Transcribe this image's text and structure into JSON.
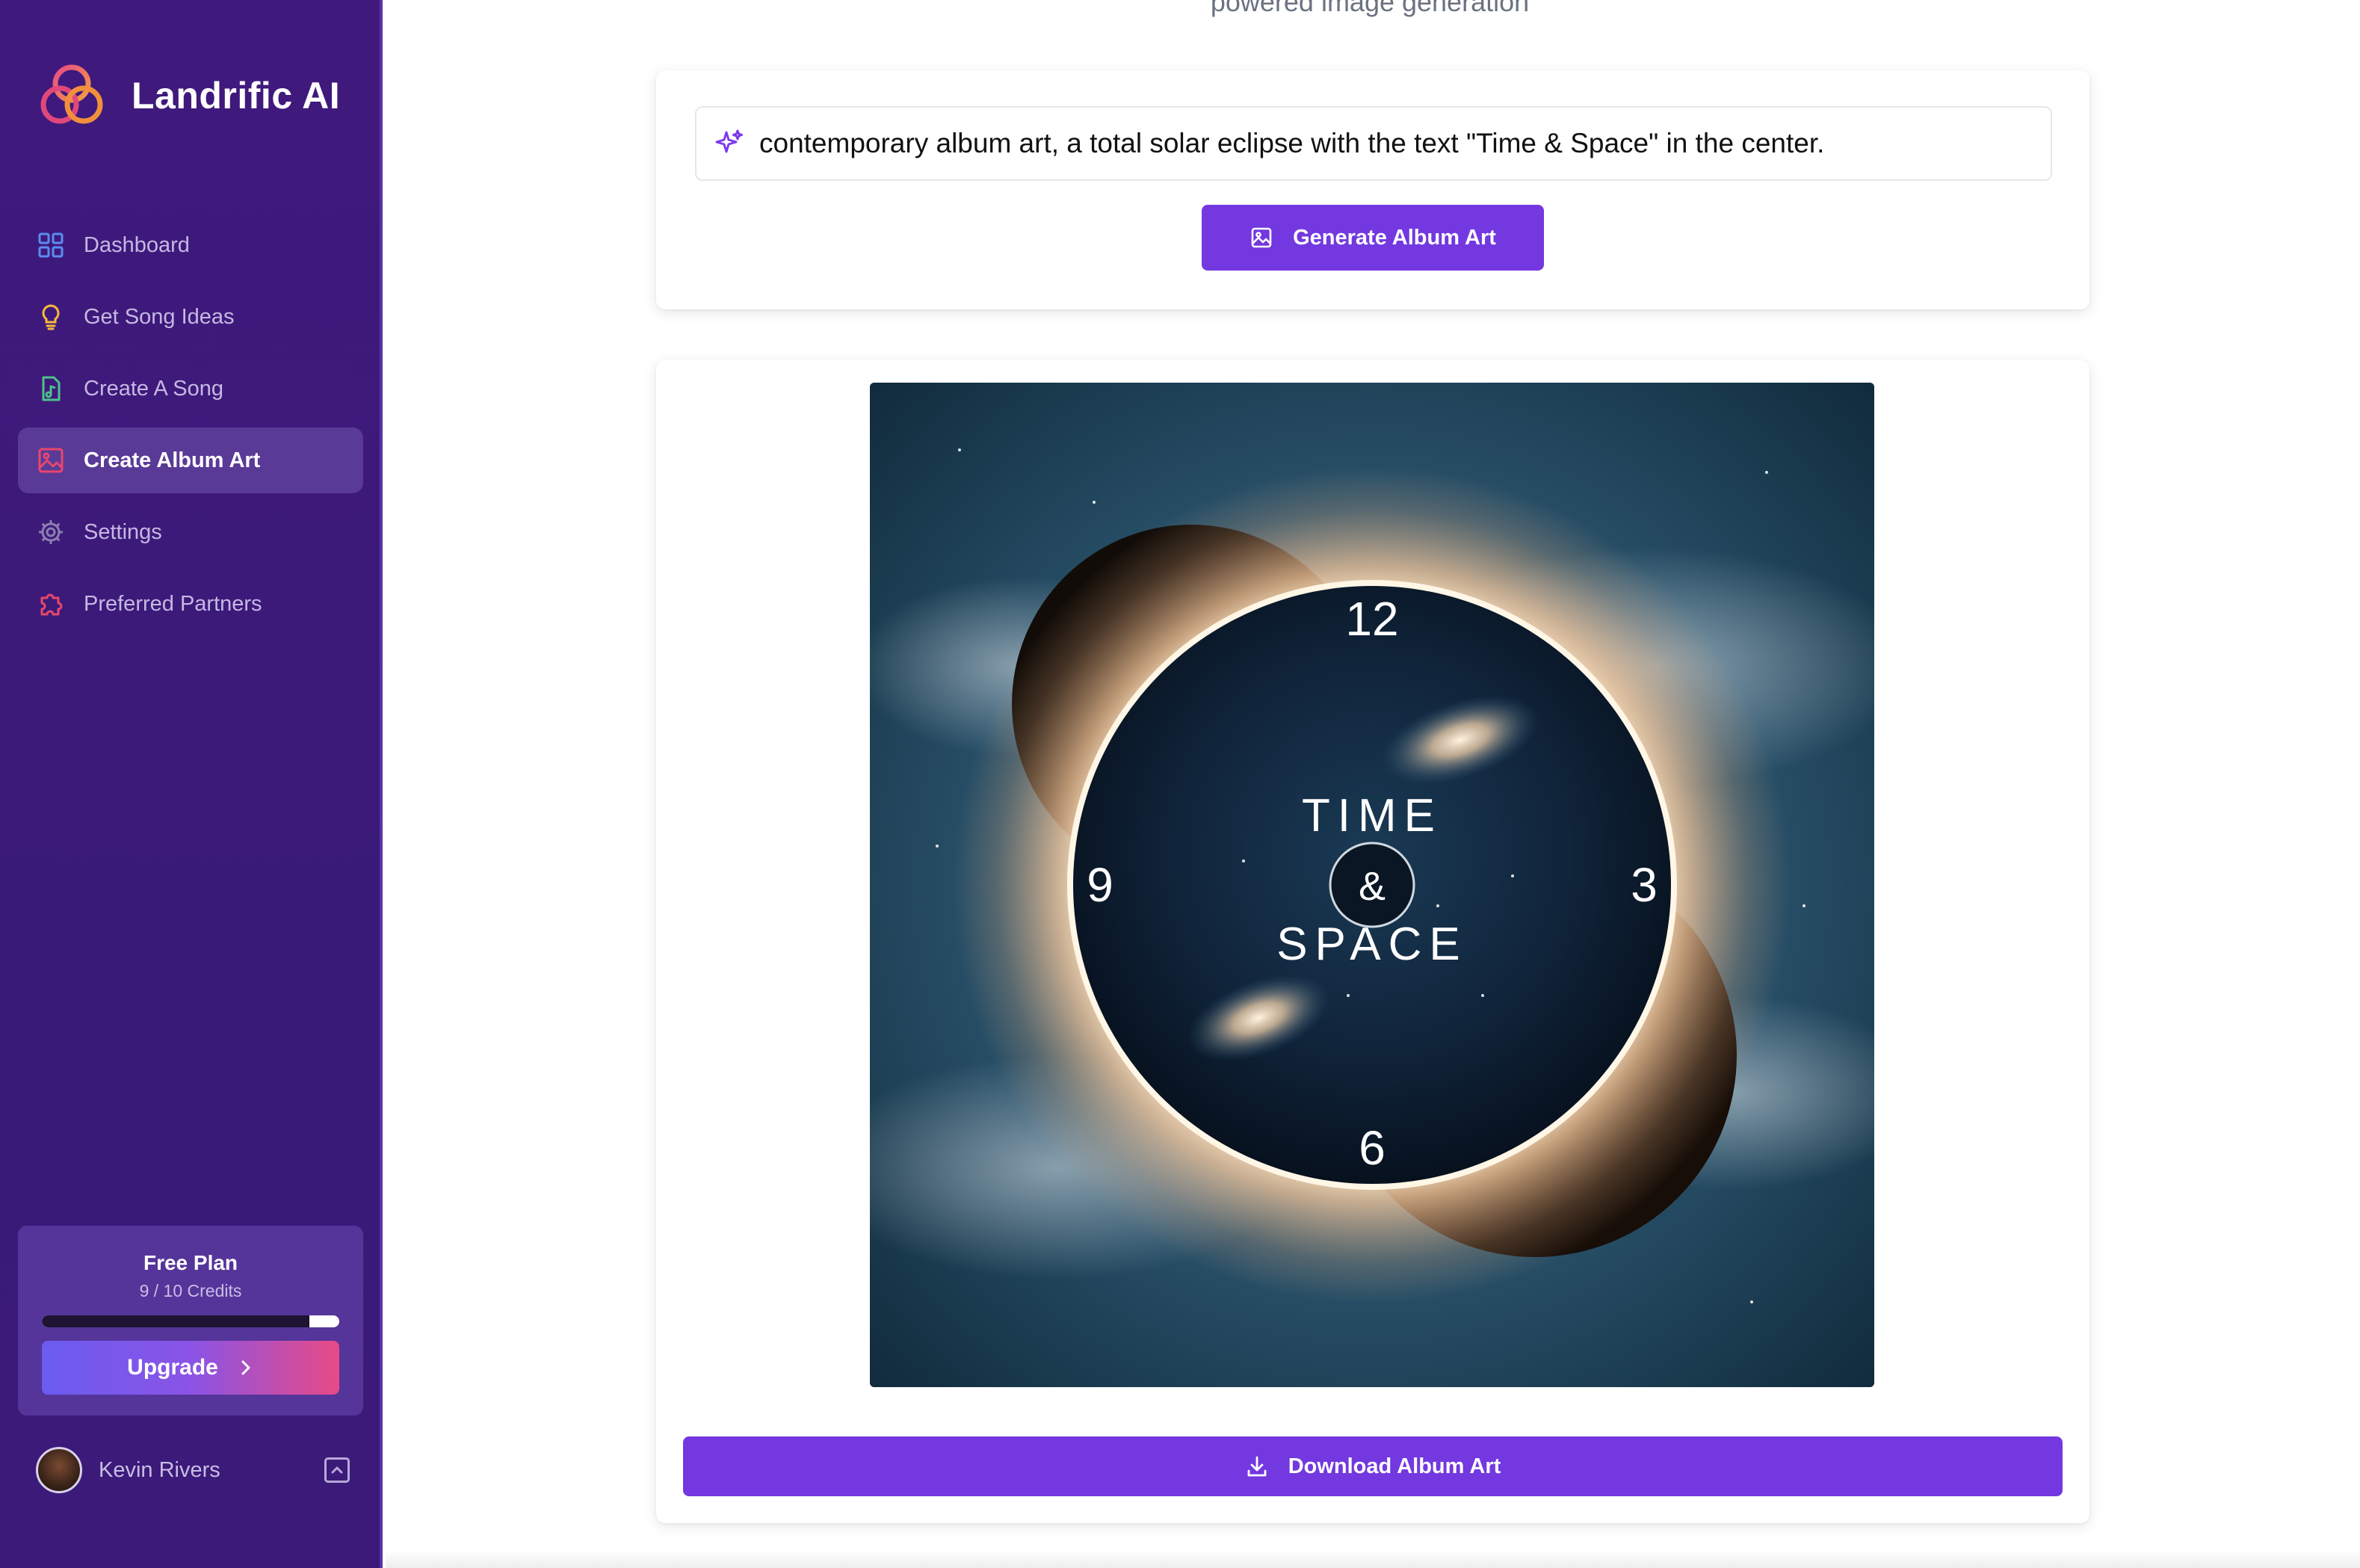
{
  "app": {
    "name": "Landrific AI"
  },
  "sidebar": {
    "items": [
      {
        "label": "Dashboard",
        "icon": "grid-icon",
        "color": "#5b8def"
      },
      {
        "label": "Get Song Ideas",
        "icon": "lightbulb-icon",
        "color": "#f5b83d"
      },
      {
        "label": "Create A Song",
        "icon": "music-file-icon",
        "color": "#4cc28a"
      },
      {
        "label": "Create Album Art",
        "icon": "image-icon",
        "color": "#e8476b",
        "active": true
      },
      {
        "label": "Settings",
        "icon": "gear-icon",
        "color": "#8c7fb0"
      },
      {
        "label": "Preferred Partners",
        "icon": "puzzle-icon",
        "color": "#e8476b"
      }
    ]
  },
  "plan": {
    "title": "Free Plan",
    "credits": "9 / 10 Credits",
    "used_fraction": 0.9,
    "upgrade_label": "Upgrade"
  },
  "user": {
    "name": "Kevin Rivers"
  },
  "header": {
    "subtitle": "powered image generation"
  },
  "prompt": {
    "value": "contemporary album art, a total solar eclipse with the text \"Time & Space\" in the center.",
    "generate_label": "Generate Album Art"
  },
  "album_art": {
    "clock_numbers": [
      "12",
      "3",
      "6",
      "9"
    ],
    "title_top": "TIME",
    "title_mid": "&",
    "title_bottom": "SPACE"
  },
  "download": {
    "label": "Download Album Art"
  },
  "colors": {
    "sidebar": "#3e1c7a",
    "accent": "#7338e0",
    "active_item": "#5a3a97"
  }
}
